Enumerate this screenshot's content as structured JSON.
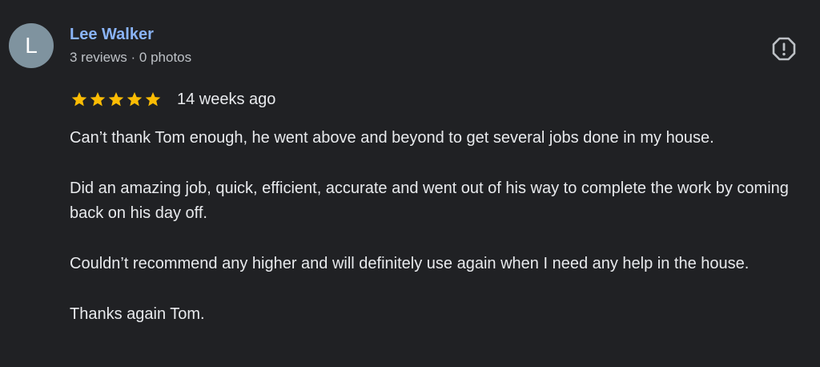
{
  "colors": {
    "background": "#202124",
    "avatar_bg": "#7f939f",
    "author_name": "#8ab4f8",
    "star": "#fbbc04",
    "text": "#e8eaed",
    "muted": "#bdc1c6"
  },
  "review": {
    "avatar_letter": "L",
    "author": "Lee Walker",
    "meta": "3 reviews · 0 photos",
    "report_icon": "report-flag-icon",
    "rating": 5,
    "rating_max": 5,
    "date": "14 weeks ago",
    "paragraphs": [
      "Can’t thank Tom enough, he went above and beyond to get several jobs done in my house.",
      "Did an amazing job, quick, efficient, accurate and went out of his way to complete the work by coming back on his day off.",
      "Couldn’t recommend any higher and will definitely use again when I need any help in the house.",
      "Thanks again Tom."
    ]
  }
}
